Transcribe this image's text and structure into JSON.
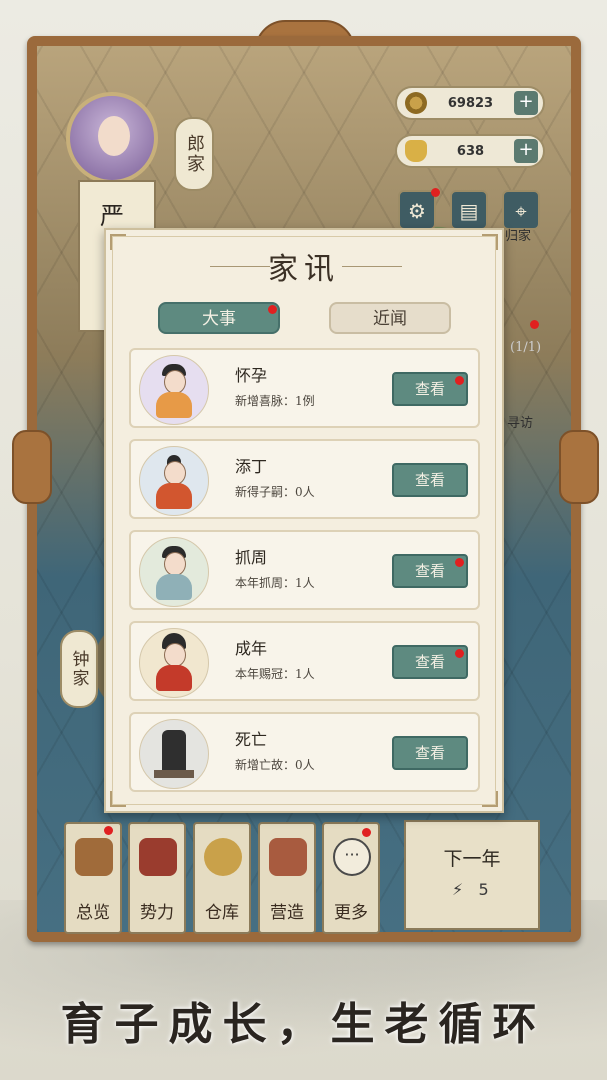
{
  "currency": {
    "coins": "69823",
    "coins_plus": "+",
    "ingots": "638",
    "ingots_plus": "+"
  },
  "map": {
    "clan_lang": "郎家",
    "clan_zhong": "钟家",
    "card_surname": "严",
    "right_label_guijia": "归家",
    "right_label_page": "(1/1)",
    "right_label_xunfang": "寻访"
  },
  "dialog": {
    "title": "家讯",
    "tabs": [
      {
        "label": "大事"
      },
      {
        "label": "近闻"
      }
    ],
    "rows": [
      {
        "title": "怀孕",
        "subtitle": "新增喜脉：1例",
        "button": "查看"
      },
      {
        "title": "添丁",
        "subtitle": "新得子嗣：0人",
        "button": "查看"
      },
      {
        "title": "抓周",
        "subtitle": "本年抓周：1人",
        "button": "查看"
      },
      {
        "title": "成年",
        "subtitle": "本年赐冠：1人",
        "button": "查看"
      },
      {
        "title": "死亡",
        "subtitle": "新增亡故：0人",
        "button": "查看"
      }
    ]
  },
  "bottom_menu": {
    "items": [
      {
        "label": "总览",
        "icon": "brush-icon"
      },
      {
        "label": "势力",
        "icon": "pavilion-icon"
      },
      {
        "label": "仓库",
        "icon": "treasure-bag-icon"
      },
      {
        "label": "营造",
        "icon": "trowel-icon"
      },
      {
        "label": "更多",
        "icon": "more-dots-icon"
      }
    ],
    "next_year": "下一年",
    "energy": "5"
  },
  "slogan": "育子成长，生老循环",
  "colors": {
    "accent_green": "#5e8a80",
    "frame_brown": "#9b6a3c",
    "notify_red": "#e02020"
  }
}
